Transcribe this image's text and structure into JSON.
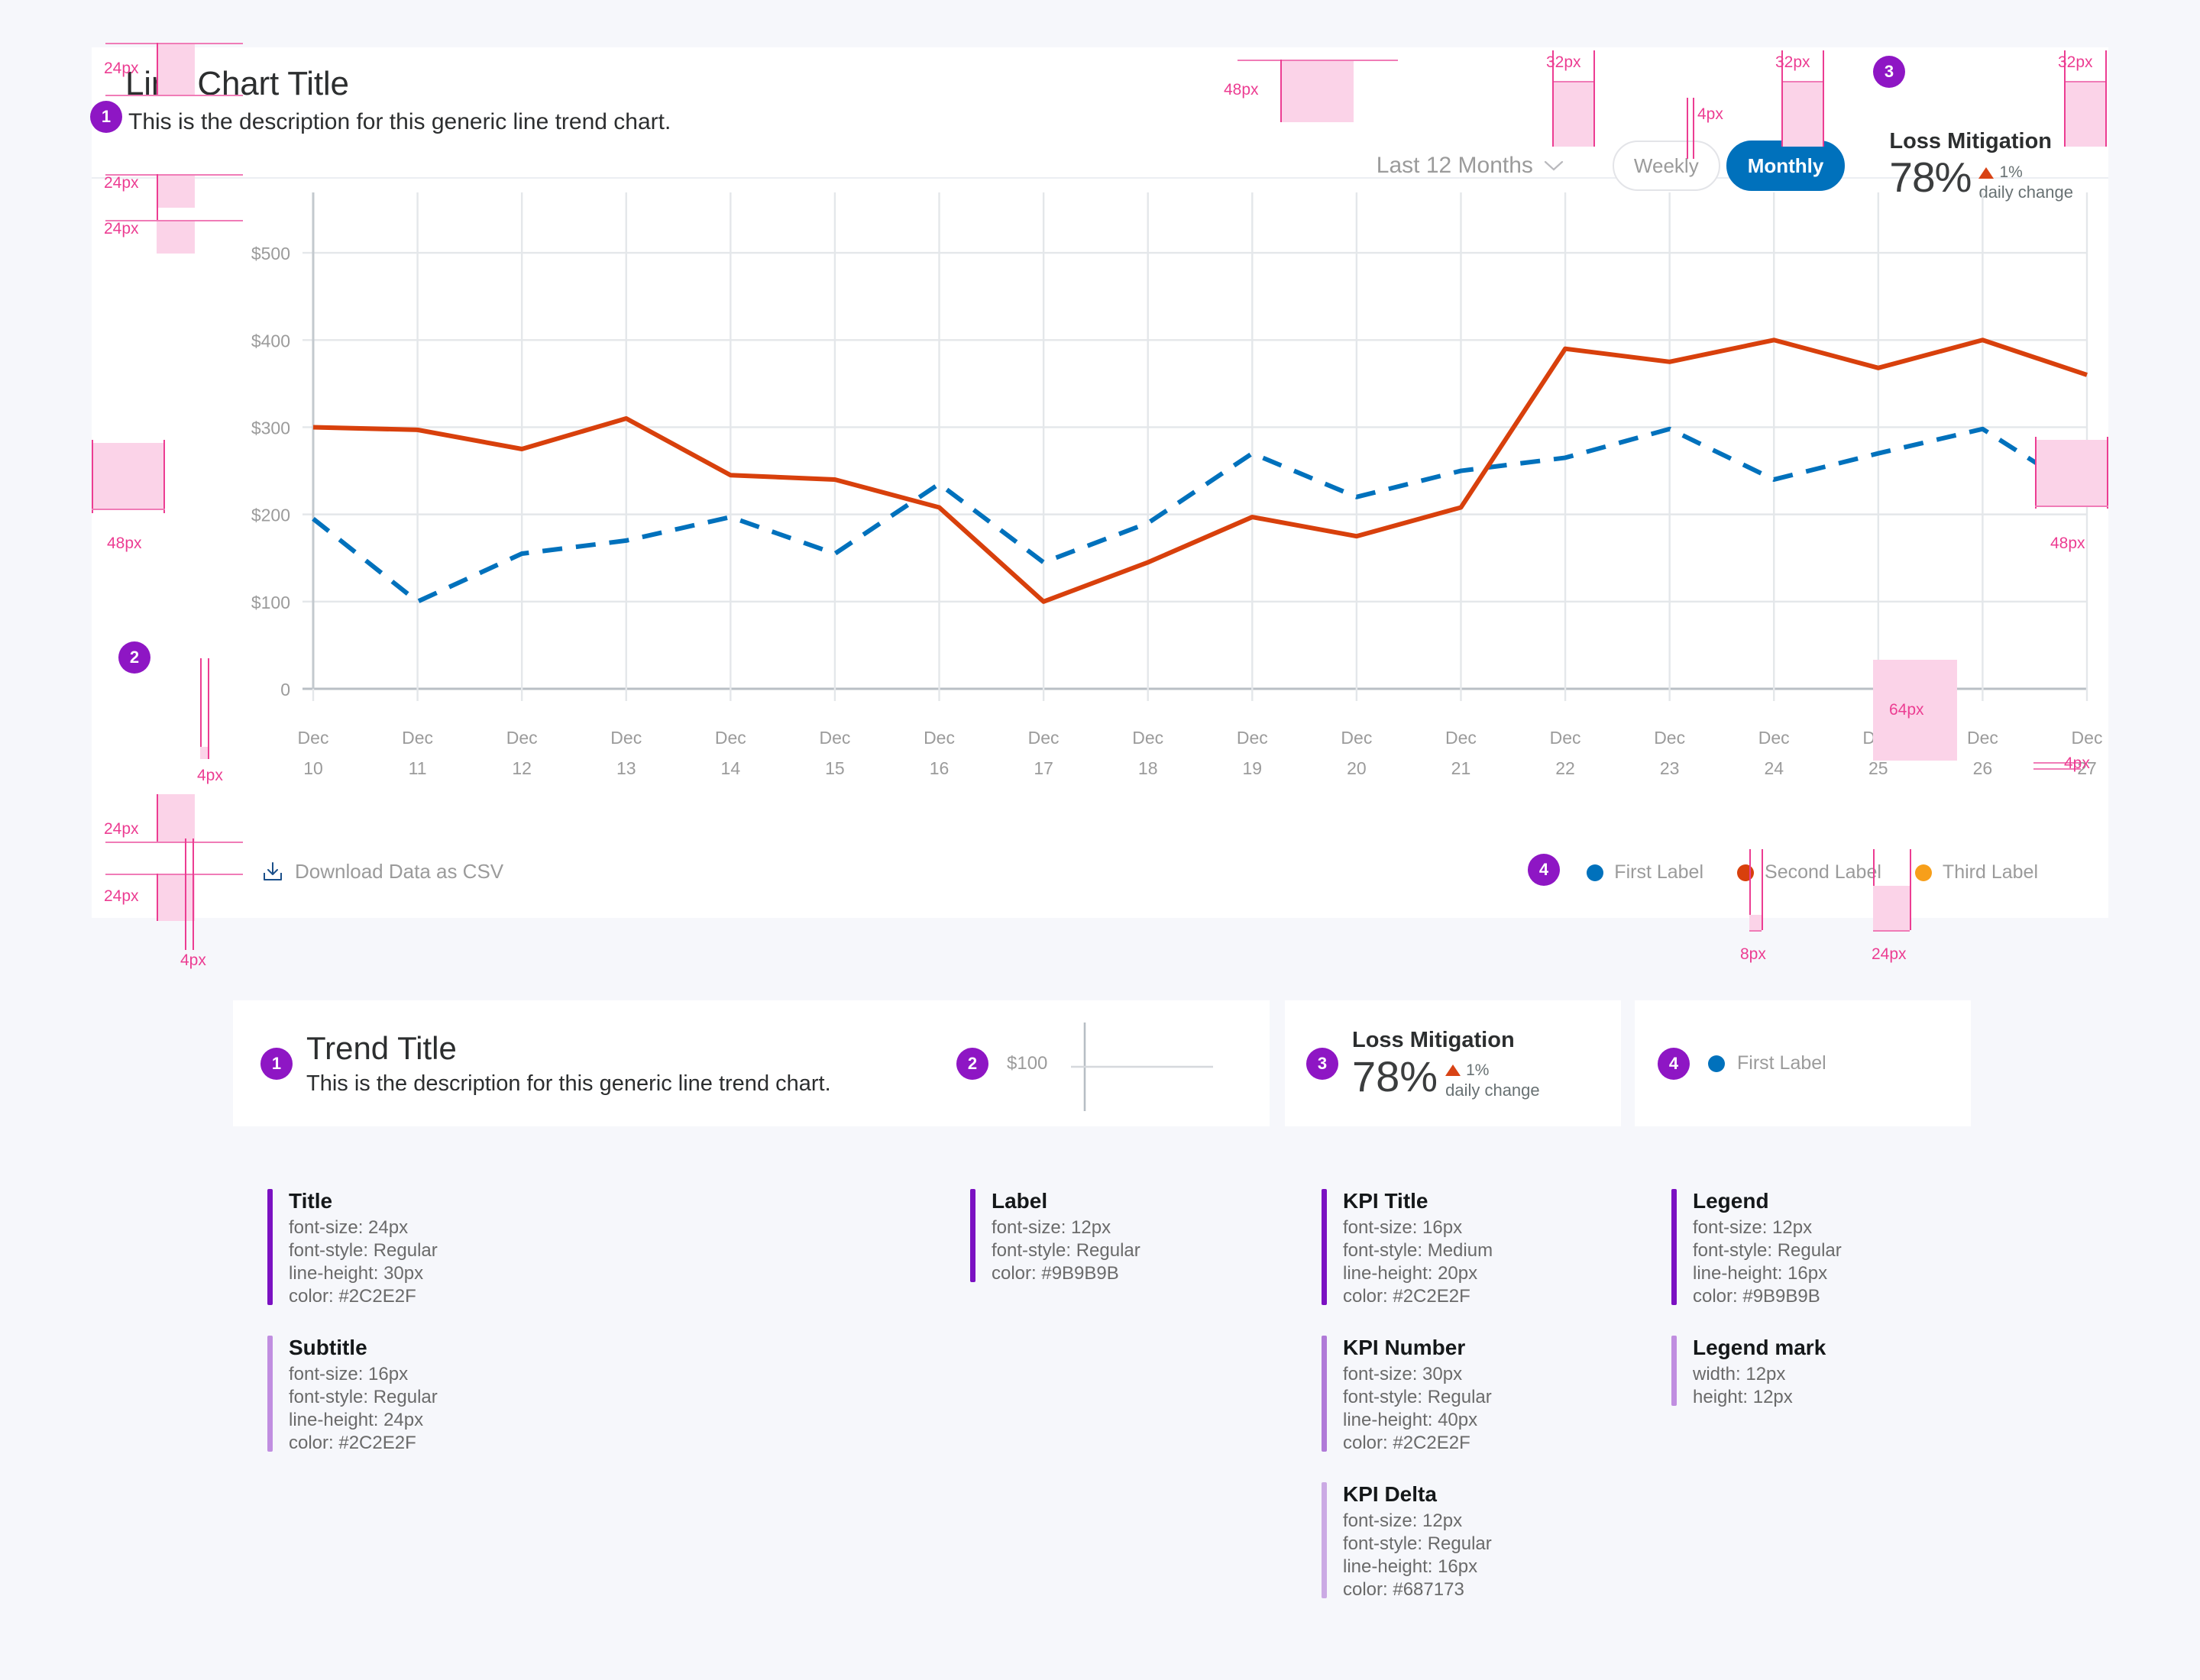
{
  "chart_card": {
    "title": "Line Chart Title",
    "subtitle": "This is the description for this generic line trend chart.",
    "dropdown": {
      "value": "Last 12 Months",
      "icon": "chevron-down-icon"
    },
    "toggle": {
      "weekly": "Weekly",
      "monthly": "Monthly",
      "selected": "Monthly"
    },
    "kpi": {
      "title": "Loss Mitigation",
      "value": "78%",
      "delta": "1%",
      "delta_direction": "up",
      "delta_caption": "daily change",
      "delta_color": "#d84315"
    },
    "csv": {
      "label": "Download Data as CSV",
      "icon": "download-icon"
    },
    "legend": [
      {
        "label": "First Label",
        "color": "#0071bc"
      },
      {
        "label": "Second Label",
        "color": "#d8400c"
      },
      {
        "label": "Third Label",
        "color": "#f79f1a"
      }
    ]
  },
  "chart_data": {
    "type": "line",
    "title": "Line Chart Title",
    "subtitle": "This is the description for this generic line trend chart.",
    "xlabel": "",
    "ylabel": "",
    "ylim": [
      0,
      550
    ],
    "yticks": [
      0,
      100,
      200,
      300,
      400,
      500
    ],
    "ytick_labels": [
      "0",
      "$100",
      "$200",
      "$300",
      "$400",
      "$500"
    ],
    "grid": true,
    "legend_position": "bottom-right",
    "categories": [
      "Dec 10",
      "Dec 11",
      "Dec 12",
      "Dec 13",
      "Dec 14",
      "Dec 15",
      "Dec 16",
      "Dec 17",
      "Dec 18",
      "Dec 19",
      "Dec 20",
      "Dec 21",
      "Dec 22",
      "Dec 23",
      "Dec 24",
      "Dec 25",
      "Dec 26",
      "Dec 27"
    ],
    "series": [
      {
        "name": "First Label",
        "color": "#0071bc",
        "style": "dashed",
        "values": [
          195,
          100,
          155,
          170,
          197,
          155,
          235,
          145,
          190,
          270,
          220,
          250,
          265,
          298,
          240,
          270,
          298,
          222
        ]
      },
      {
        "name": "Second Label",
        "color": "#d8400c",
        "style": "solid",
        "values": [
          300,
          297,
          275,
          310,
          245,
          240,
          208,
          100,
          145,
          197,
          175,
          208,
          390,
          375,
          400,
          368,
          400,
          360
        ]
      }
    ]
  },
  "redlines": [
    {
      "id": "title-top",
      "text": "24px"
    },
    {
      "id": "title-gap",
      "text": "24px"
    },
    {
      "id": "subtitle-bottom",
      "text": "24px"
    },
    {
      "id": "header-height",
      "text": "48px"
    },
    {
      "id": "dropdown-gap",
      "text": "32px"
    },
    {
      "id": "toggle-gap",
      "text": "4px"
    },
    {
      "id": "kpi-gap",
      "text": "32px"
    },
    {
      "id": "kpi-right",
      "text": "32px"
    },
    {
      "id": "ylabel-left",
      "text": "48px"
    },
    {
      "id": "yaxis-pad",
      "text": "4px"
    },
    {
      "id": "plot-right",
      "text": "48px"
    },
    {
      "id": "xaxis-pad",
      "text": "4px"
    },
    {
      "id": "xlabel-gap",
      "text": "64px"
    },
    {
      "id": "csv-top",
      "text": "24px"
    },
    {
      "id": "csv-bottom",
      "text": "24px"
    },
    {
      "id": "csv-icon-gap",
      "text": "4px"
    },
    {
      "id": "legend-mark-gap",
      "text": "8px"
    },
    {
      "id": "legend-item-gap",
      "text": "24px"
    }
  ],
  "specs": {
    "col1": {
      "sample": {
        "badge": "1",
        "title": "Trend Title",
        "subtitle": "This is the description for this generic line trend chart."
      },
      "items": [
        {
          "name": "Title",
          "bar_color": "#7b11c2",
          "lines": [
            "font-size: 24px",
            "font-style: Regular",
            "line-height: 30px",
            "color: #2C2E2F"
          ]
        },
        {
          "name": "Subtitle",
          "bar_color": "#c08ee0",
          "lines": [
            "font-size: 16px",
            "font-style: Regular",
            "line-height: 24px",
            "color: #2C2E2F"
          ]
        }
      ]
    },
    "col2": {
      "sample": {
        "badge": "2",
        "label": "$100"
      },
      "items": [
        {
          "name": "Label",
          "bar_color": "#7b11c2",
          "lines": [
            "font-size: 12px",
            "font-style: Regular",
            "color: #9B9B9B"
          ]
        }
      ]
    },
    "col3": {
      "sample": {
        "badge": "3",
        "title": "Loss Mitigation",
        "value": "78%",
        "delta": "1%",
        "delta_caption": "daily change"
      },
      "items": [
        {
          "name": "KPI Title",
          "bar_color": "#7b11c2",
          "lines": [
            "font-size: 16px",
            "font-style: Medium",
            "line-height: 20px",
            "color: #2C2E2F"
          ]
        },
        {
          "name": "KPI Number",
          "bar_color": "#b07ad8",
          "lines": [
            "font-size: 30px",
            "font-style: Regular",
            "line-height: 40px",
            "color: #2C2E2F"
          ]
        },
        {
          "name": "KPI Delta",
          "bar_color": "#cbaae4",
          "lines": [
            "font-size: 12px",
            "font-style: Regular",
            "line-height: 16px",
            "color: #687173"
          ]
        }
      ]
    },
    "col4": {
      "sample": {
        "badge": "4",
        "label": "First Label",
        "mark_color": "#0071bc"
      },
      "items": [
        {
          "name": "Legend",
          "bar_color": "#7b11c2",
          "lines": [
            "font-size: 12px",
            "font-style: Regular",
            "line-height: 16px",
            "color: #9B9B9B"
          ]
        },
        {
          "name": "Legend mark",
          "bar_color": "#c08ee0",
          "lines": [
            "width: 12px",
            "height: 12px"
          ]
        }
      ]
    }
  },
  "badges": {
    "one": "1",
    "two": "2",
    "three": "3",
    "four": "4"
  },
  "colors": {
    "accent_purple": "#8e16c4",
    "redline": "#ec3d92",
    "redline_fill": "#fbd3e8",
    "series_blue": "#0071bc",
    "series_orange": "#d8400c",
    "series_yellow": "#f79f1a",
    "text_dark": "#2C2E2F",
    "text_muted": "#9B9B9B",
    "delta_grey": "#687173"
  }
}
